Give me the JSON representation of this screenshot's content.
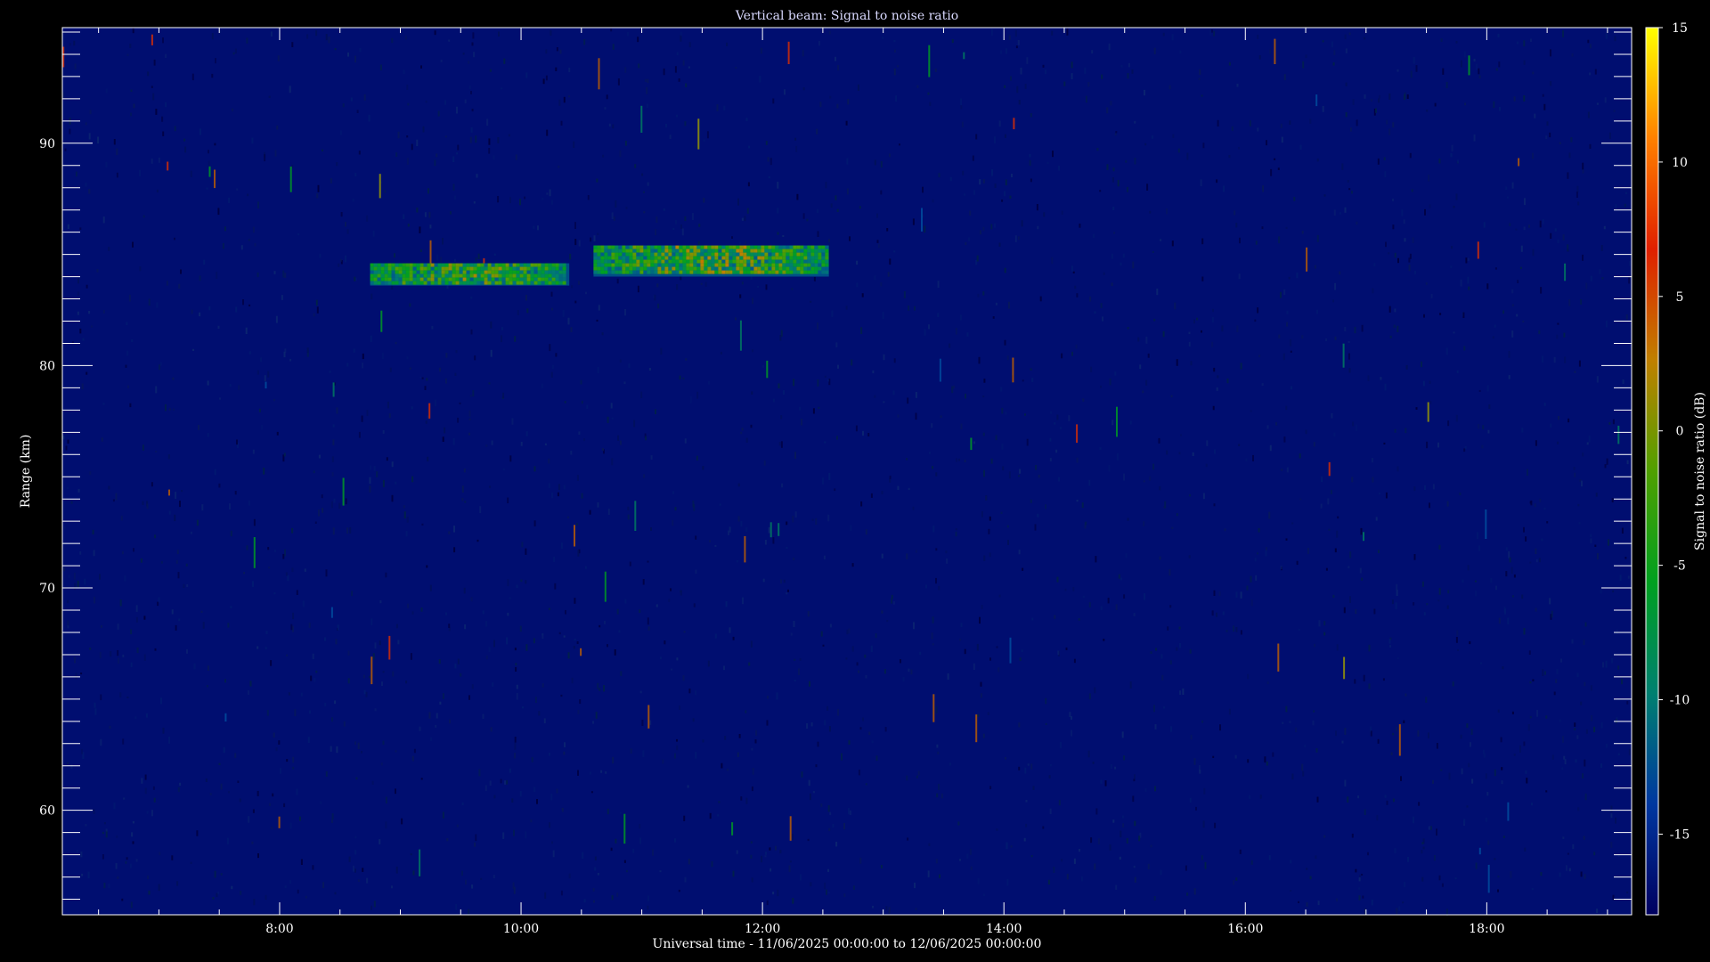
{
  "chart_data": {
    "type": "heatmap",
    "title": "Vertical beam: Signal to noise ratio",
    "xlabel": "Universal time - 11/06/2025 00:00:00 to 12/06/2025 00:00:00",
    "ylabel": "Range (km)",
    "colorbar_label": "Signal to noise ratio (dB)",
    "x_unit": "hours UT",
    "xlim": [
      6.2,
      19.2
    ],
    "ylim": [
      55.3,
      95.2
    ],
    "x_ticks": [
      8,
      10,
      12,
      14,
      16,
      18
    ],
    "x_tick_labels": [
      "8:00",
      "10:00",
      "12:00",
      "14:00",
      "16:00",
      "18:00"
    ],
    "y_ticks": [
      60,
      70,
      80,
      90
    ],
    "y_tick_labels": [
      "60",
      "70",
      "80",
      "90"
    ],
    "colorbar_range": [
      -18,
      15
    ],
    "colorbar_ticks": [
      15,
      10,
      5,
      0,
      -5,
      -10,
      -15
    ],
    "colorbar_tick_labels": [
      "15",
      "10",
      "5",
      "0",
      "-5",
      "-10",
      "-15"
    ],
    "background_snr_db": -17,
    "features": [
      {
        "t_start": 8.75,
        "t_end": 10.4,
        "range_low": 83.6,
        "range_high": 84.6,
        "snr_peak_db": 2
      },
      {
        "t_start": 10.6,
        "t_end": 12.55,
        "range_low": 84.0,
        "range_high": 85.4,
        "snr_peak_db": 3
      }
    ],
    "colormap": [
      "#000060",
      "#0038a0",
      "#008070",
      "#00a020",
      "#50a000",
      "#c08000",
      "#e02000",
      "#ff8000",
      "#ffff00"
    ]
  }
}
